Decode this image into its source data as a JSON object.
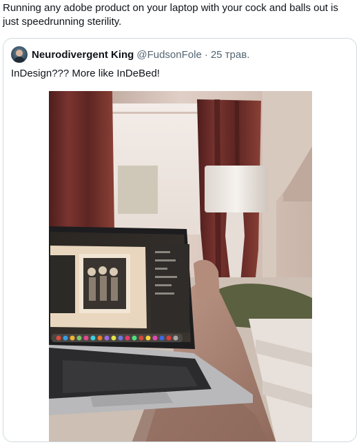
{
  "tweet": {
    "text": "Running any adobe product on your laptop with your cock and balls out is just speedrunning sterility."
  },
  "quote": {
    "display_name": "Neurodivergent King",
    "handle": "@FudsonFole",
    "separator": "·",
    "date": "25 трав.",
    "text": "InDesign??? More like InDeBed!"
  },
  "photo": {
    "subject": "laptop-on-lap-bedroom-photo"
  }
}
